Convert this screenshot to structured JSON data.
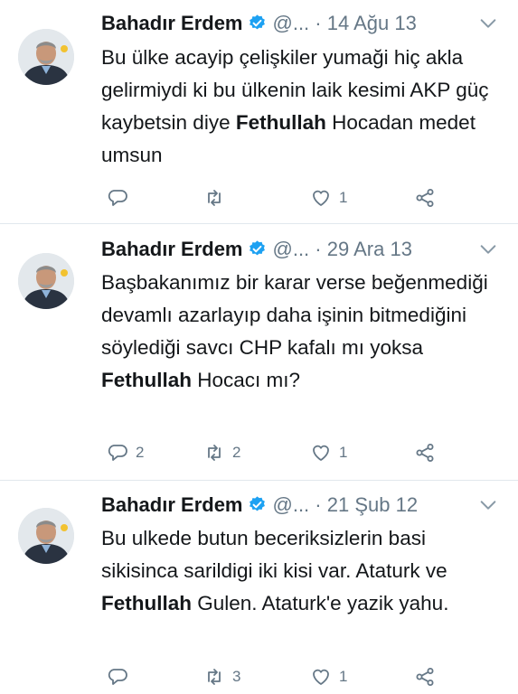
{
  "tweets": [
    {
      "author_name": "Bahadır Erdem",
      "handle": "@...",
      "separator": "·",
      "date": "14 Ağu 13",
      "text_parts": [
        {
          "text": "Bu ülke acayip çelişkiler yumaği hiç akla gelirmiydi ki bu ülkenin laik kesimi AKP güç kaybetsin diye ",
          "bold": false
        },
        {
          "text": "Fethullah",
          "bold": true
        },
        {
          "text": " Hocadan medet umsun",
          "bold": false
        }
      ],
      "replies": "",
      "retweets": "",
      "likes": "1"
    },
    {
      "author_name": "Bahadır Erdem",
      "handle": "@...",
      "separator": "·",
      "date": "29 Ara 13",
      "text_parts": [
        {
          "text": "Başbakanımız bir karar verse beğenmediği devamlı azarlayıp daha işinin bitmediğini söylediği savcı CHP kafalı mı yoksa ",
          "bold": false
        },
        {
          "text": "Fethullah",
          "bold": true
        },
        {
          "text": " Hocacı mı?",
          "bold": false
        }
      ],
      "replies": "2",
      "retweets": "2",
      "likes": "1"
    },
    {
      "author_name": "Bahadır Erdem",
      "handle": "@...",
      "separator": "·",
      "date": "21 Şub 12",
      "text_parts": [
        {
          "text": "Bu ulkede butun beceriksizlerin basi sikisinca sarildigi iki kisi var. Ataturk ve ",
          "bold": false
        },
        {
          "text": "Fethullah",
          "bold": true
        },
        {
          "text": " Gulen. Ataturk'e yazik yahu.",
          "bold": false
        }
      ],
      "replies": "",
      "retweets": "3",
      "likes": "1"
    }
  ],
  "colors": {
    "text": "#14171a",
    "secondary": "#657786",
    "verified": "#1da1f2",
    "divider": "#e1e8ed"
  }
}
